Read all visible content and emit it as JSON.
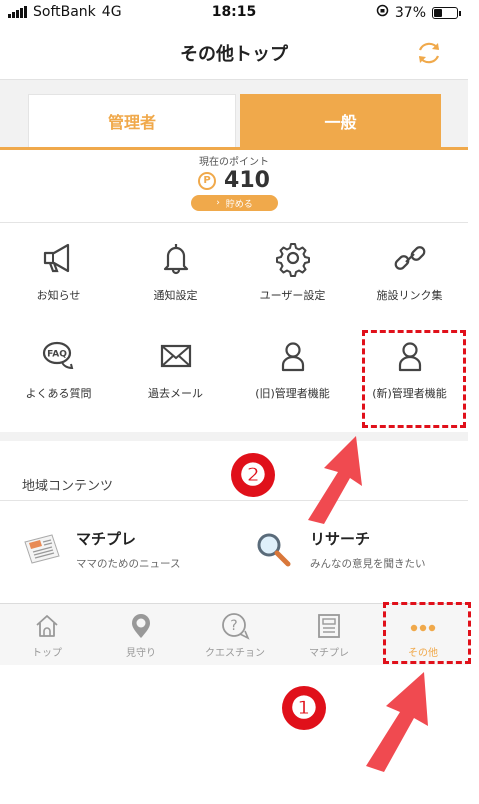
{
  "status_bar": {
    "carrier": "SoftBank",
    "network": "4G",
    "time": "18:15",
    "battery_percent": "37%",
    "battery_level": 0.37
  },
  "nav": {
    "title": "その他トップ",
    "refresh_icon": "refresh-icon"
  },
  "segments": {
    "admin": "管理者",
    "general": "一般",
    "selected": "general"
  },
  "points": {
    "label": "現在のポイント",
    "value": "410",
    "icon_text": "P",
    "save_button": "貯める"
  },
  "menu": [
    {
      "label": "お知らせ",
      "icon": "megaphone-icon"
    },
    {
      "label": "通知設定",
      "icon": "bell-icon"
    },
    {
      "label": "ユーザー設定",
      "icon": "gear-icon"
    },
    {
      "label": "施設リンク集",
      "icon": "link-icon"
    },
    {
      "label": "よくある質問",
      "icon": "faq-icon",
      "icon_text": "FAQ"
    },
    {
      "label": "過去メール",
      "icon": "mail-icon"
    },
    {
      "label": "(旧)管理者機能",
      "icon": "person-icon"
    },
    {
      "label": "(新)管理者機能",
      "icon": "person-icon"
    }
  ],
  "region": {
    "title": "地域コンテンツ",
    "items": [
      {
        "title": "マチプレ",
        "subtitle": "ママのためのニュース",
        "icon": "newspaper-icon"
      },
      {
        "title": "リサーチ",
        "subtitle": "みんなの意見を聞きたい",
        "icon": "magnifier-icon"
      }
    ]
  },
  "tabbar": {
    "items": [
      {
        "label": "トップ",
        "icon": "home-icon"
      },
      {
        "label": "見守り",
        "icon": "location-pin-icon"
      },
      {
        "label": "クエスチョン",
        "icon": "question-bubble-icon"
      },
      {
        "label": "マチプレ",
        "icon": "news-icon"
      },
      {
        "label": "その他",
        "icon": "more-dots-icon"
      }
    ],
    "active": 4
  },
  "annotations": {
    "step1": "❶",
    "step2": "❷"
  },
  "colors": {
    "accent": "#f0a94b",
    "annotation_red": "#e0101a",
    "arrow": "#f04a50"
  }
}
